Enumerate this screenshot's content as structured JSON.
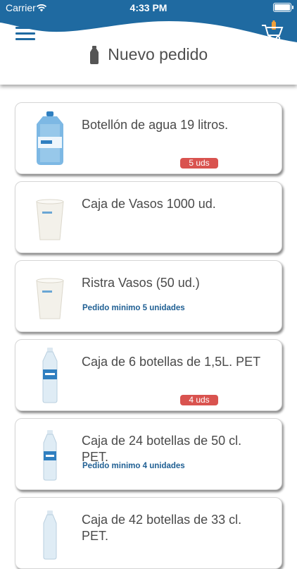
{
  "status_bar": {
    "carrier": "Carrier",
    "time": "4:33 PM"
  },
  "header": {
    "title": "Nuevo pedido",
    "brand_color": "#1f6aa1"
  },
  "products": [
    {
      "name": "Botellón de agua 19 litros.",
      "badge": "5 uds",
      "image": "water-jug-icon"
    },
    {
      "name": "Caja de Vasos 1000 ud.",
      "image": "cup-icon"
    },
    {
      "name": "Ristra Vasos (50 ud.)",
      "note": "Pedido minimo 5 unidades",
      "image": "cup-icon"
    },
    {
      "name": "Caja de 6 botellas de 1,5L. PET",
      "badge": "4 uds",
      "image": "bottle-icon"
    },
    {
      "name": "Caja de 24 botellas de 50 cl. PET.",
      "note": "Pedido minimo 4 unidades",
      "image": "bottle-icon"
    },
    {
      "name": "Caja de 42 botellas de 33 cl. PET.",
      "image": "bottle-icon"
    }
  ]
}
